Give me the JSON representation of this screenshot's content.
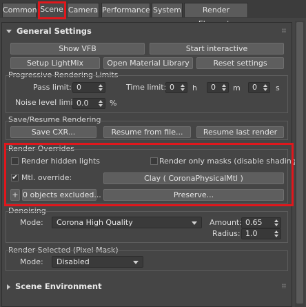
{
  "tabs": [
    "Common",
    "Scene",
    "Camera",
    "Performance",
    "System",
    "Render Elements"
  ],
  "general": {
    "title": "General Settings",
    "buttons": {
      "show_vfb": "Show VFB",
      "start_interactive": "Start interactive",
      "setup_lightmix": "Setup LightMix",
      "open_material_library": "Open Material Library",
      "reset_settings": "Reset settings"
    },
    "progressive": {
      "title": "Progressive Rendering Limits",
      "pass_limit_label": "Pass limit:",
      "pass_limit": "0",
      "time_limit_label": "Time limit:",
      "hours": "0",
      "h": "h",
      "minutes": "0",
      "m": "m",
      "seconds": "0",
      "s": "s",
      "noise_label": "Noise level limit:",
      "noise_value": "0.0",
      "percent": "%"
    },
    "save_resume": {
      "title": "Save/Resume Rendering",
      "save_cxr": "Save CXR...",
      "resume_from_file": "Resume from file...",
      "resume_last_render": "Resume last render"
    },
    "overrides": {
      "title": "Render Overrides",
      "render_hidden_lights": "Render hidden lights",
      "render_only_masks": "Render only masks (disable shading)",
      "mtl_override_label": "Mtl. override:",
      "mtl_override_checked": "✔",
      "clay_button": "Clay  (  CoronaPhysicalMtl )",
      "plus": "+",
      "objects_excluded": "0 objects excluded...",
      "preserve": "Preserve..."
    },
    "denoising": {
      "title": "Denoising",
      "mode_label": "Mode:",
      "mode_value": "Corona High Quality",
      "amount_label": "Amount:",
      "amount_value": "0.65",
      "radius_label": "Radius:",
      "radius_value": "1.0"
    },
    "render_selected": {
      "title": "Render Selected (Pixel Mask)",
      "mode_label": "Mode:",
      "mode_value": "Disabled"
    }
  },
  "scene_environment": {
    "title": "Scene Environment"
  },
  "highlight_color": "#e0171c"
}
